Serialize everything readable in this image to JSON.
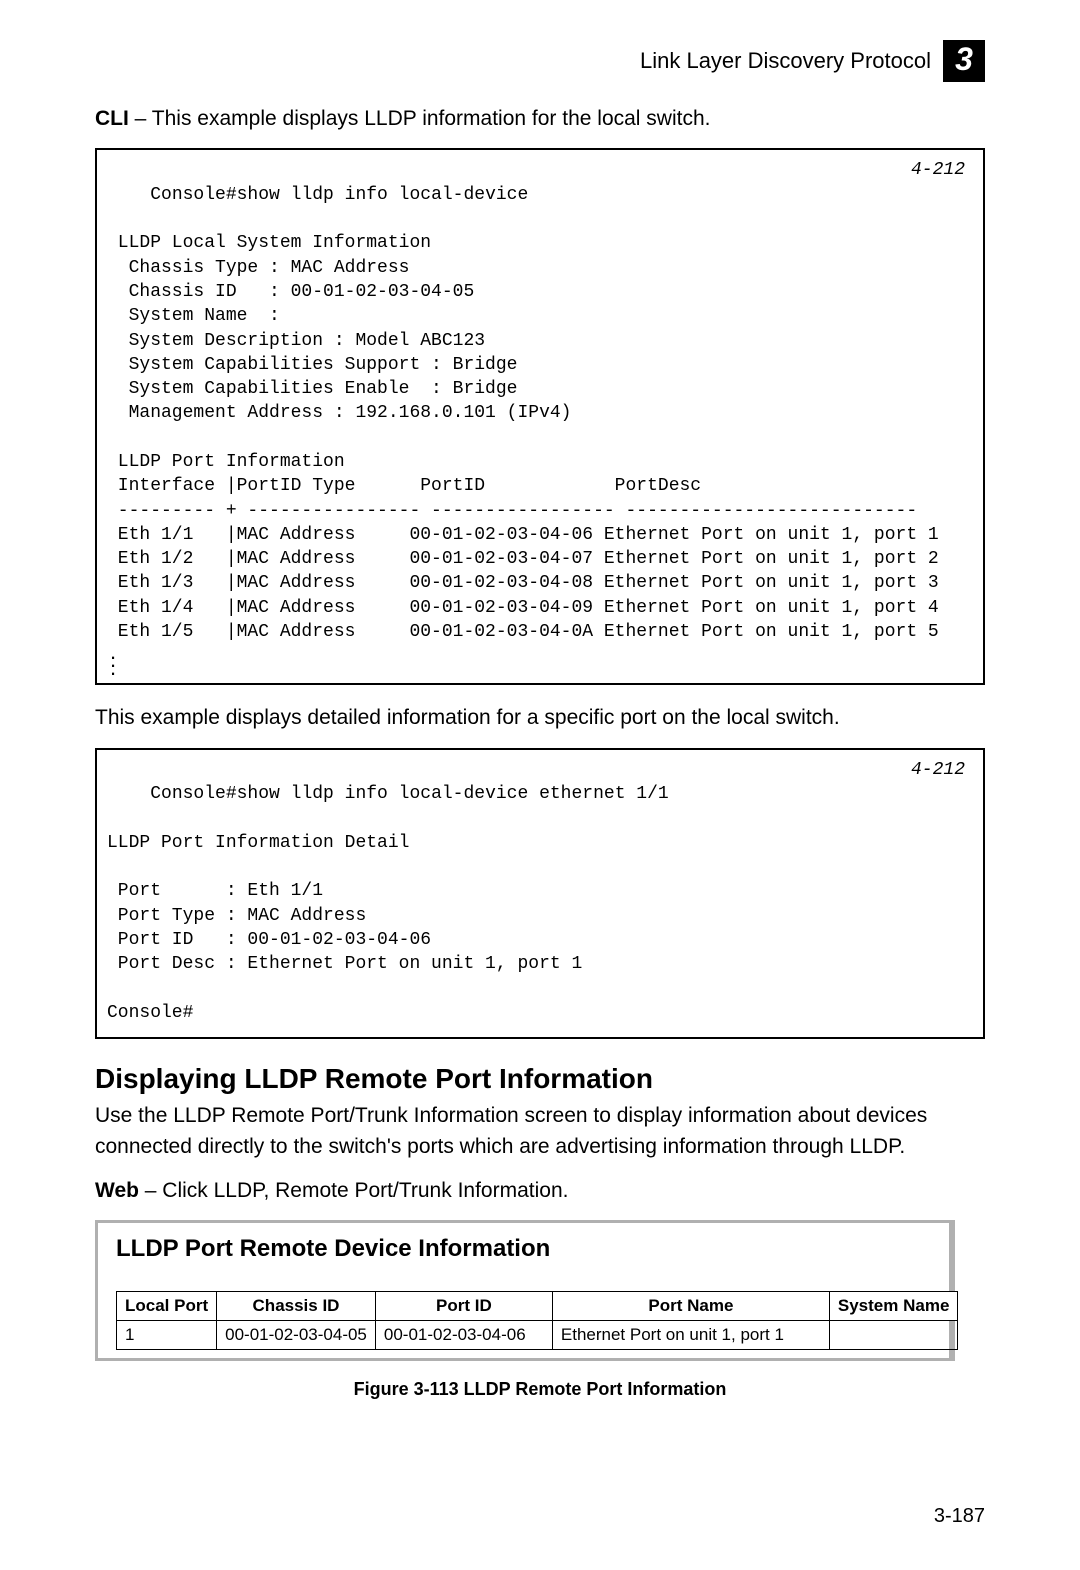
{
  "header": {
    "title": "Link Layer Discovery Protocol",
    "chapter": "3"
  },
  "intro1": {
    "bold": "CLI",
    "rest": " – This example displays LLDP information for the local switch."
  },
  "cli1": {
    "page_ref": "4-212",
    "line1": "Console#show lldp info local-device",
    "line2": "",
    "line3": " LLDP Local System Information",
    "line4": "  Chassis Type : MAC Address",
    "line5": "  Chassis ID   : 00-01-02-03-04-05",
    "line6": "  System Name  :",
    "line7": "  System Description : Model ABC123",
    "line8": "  System Capabilities Support : Bridge",
    "line9": "  System Capabilities Enable  : Bridge",
    "line10": "  Management Address : 192.168.0.101 (IPv4)",
    "line11": "",
    "line12": " LLDP Port Information",
    "line13": " Interface |PortID Type      PortID            PortDesc",
    "line14": " --------- + ---------------- ----------------- ---------------------------",
    "line15": " Eth 1/1   |MAC Address     00-01-02-03-04-06 Ethernet Port on unit 1, port 1",
    "line16": " Eth 1/2   |MAC Address     00-01-02-03-04-07 Ethernet Port on unit 1, port 2",
    "line17": " Eth 1/3   |MAC Address     00-01-02-03-04-08 Ethernet Port on unit 1, port 3",
    "line18": " Eth 1/4   |MAC Address     00-01-02-03-04-09 Ethernet Port on unit 1, port 4",
    "line19": " Eth 1/5   |MAC Address     00-01-02-03-04-0A Ethernet Port on unit 1, port 5"
  },
  "intro2": "This example displays detailed information for a specific port on the local switch.",
  "cli2": {
    "page_ref": "4-212",
    "line1": "Console#show lldp info local-device ethernet 1/1",
    "line2": "",
    "line3": "LLDP Port Information Detail",
    "line4": "",
    "line5": " Port      : Eth 1/1",
    "line6": " Port Type : MAC Address",
    "line7": " Port ID   : 00-01-02-03-04-06",
    "line8": " Port Desc : Ethernet Port on unit 1, port 1",
    "line9": "",
    "line10": "Console#"
  },
  "section": {
    "heading": "Displaying LLDP Remote Port Information",
    "para": "Use the LLDP Remote Port/Trunk Information screen to display information about devices connected directly to the switch's ports which are advertising information through LLDP.",
    "web_bold": "Web",
    "web_rest": " – Click LLDP, Remote Port/Trunk Information."
  },
  "webshot": {
    "title": "LLDP Port Remote Device Information",
    "columns": {
      "c1": "Local Port",
      "c2": "Chassis ID",
      "c3": "Port ID",
      "c4": "Port Name",
      "c5": "System Name"
    },
    "row": {
      "c1": "1",
      "c2": "00-01-02-03-04-05",
      "c3": "00-01-02-03-04-06",
      "c4": "Ethernet Port on unit 1, port 1",
      "c5": ""
    }
  },
  "figure_caption": "Figure 3-113  LLDP Remote Port Information",
  "page_number": "3-187"
}
